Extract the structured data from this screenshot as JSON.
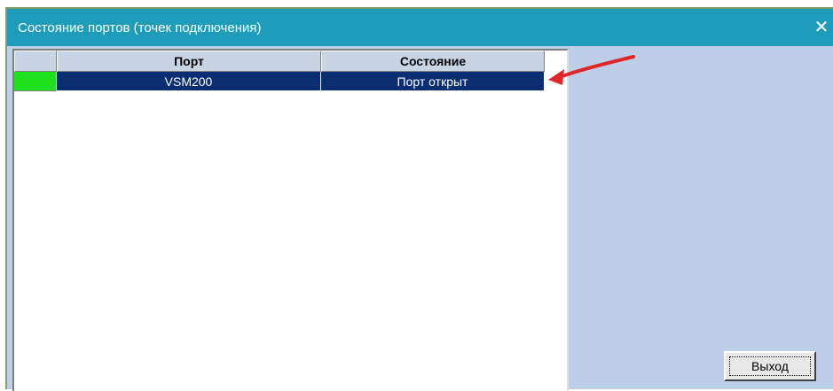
{
  "window": {
    "title": "Состояние портов (точек подключения)",
    "close_glyph": "✕"
  },
  "table": {
    "columns": [
      "",
      "Порт",
      "Состояние"
    ],
    "rows": [
      {
        "status_color": "#1fe01f",
        "port": "VSM200",
        "state": "Порт открыт"
      }
    ]
  },
  "buttons": {
    "exit_label": "Выход"
  },
  "colors": {
    "titlebar": "#1e9cba",
    "panel": "#bccfe6",
    "selection": "#0b2e72",
    "annotation_arrow": "#e0262a"
  },
  "icons": {
    "close": "close-icon",
    "annotation": "red-arrow-icon"
  }
}
